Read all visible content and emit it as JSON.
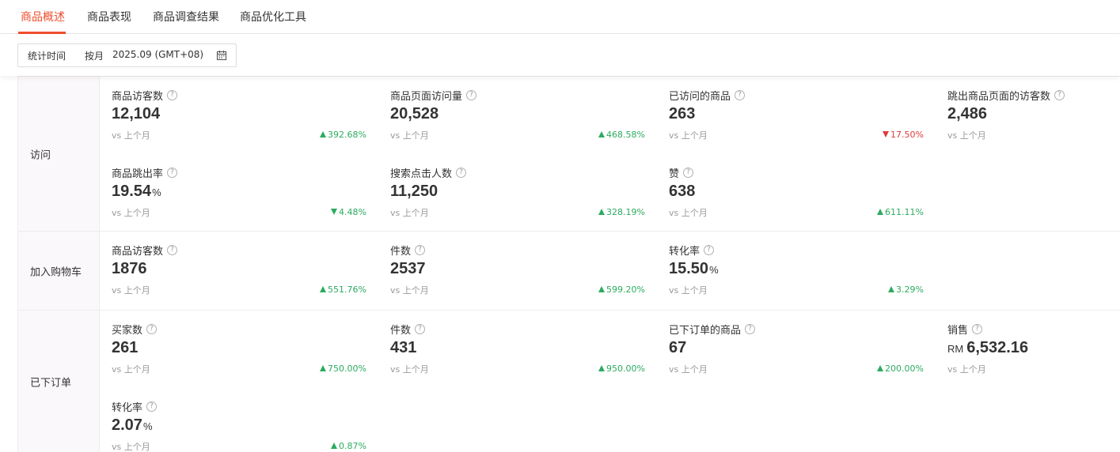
{
  "tabs": [
    {
      "label": "商品概述",
      "active": true
    },
    {
      "label": "商品表现",
      "active": false
    },
    {
      "label": "商品调查结果",
      "active": false
    },
    {
      "label": "商品优化工具",
      "active": false
    }
  ],
  "filter": {
    "label": "统计时间",
    "mode": "按月",
    "value": "2025.09 (GMT+08)",
    "icon": "calendar-icon"
  },
  "colors": {
    "accent": "#ee4d2d",
    "up": "#2dab60",
    "down": "#e03b3b"
  },
  "compare_label": "vs 上个月",
  "sections": [
    {
      "label": "访问",
      "metrics": [
        {
          "title": "商品访客数",
          "value": "12,104",
          "unit": "",
          "prefix": "",
          "change": "392.68%",
          "direction": "up"
        },
        {
          "title": "商品页面访问量",
          "value": "20,528",
          "unit": "",
          "prefix": "",
          "change": "468.58%",
          "direction": "up"
        },
        {
          "title": "已访问的商品",
          "value": "263",
          "unit": "",
          "prefix": "",
          "change": "17.50%",
          "direction": "down"
        },
        {
          "title": "跳出商品页面的访客数",
          "value": "2,486",
          "unit": "",
          "prefix": "",
          "change": "",
          "direction": ""
        },
        {
          "title": "商品跳出率",
          "value": "19.54",
          "unit": "%",
          "prefix": "",
          "change": "4.48%",
          "direction": "down-good"
        },
        {
          "title": "搜索点击人数",
          "value": "11,250",
          "unit": "",
          "prefix": "",
          "change": "328.19%",
          "direction": "up"
        },
        {
          "title": "赞",
          "value": "638",
          "unit": "",
          "prefix": "",
          "change": "611.11%",
          "direction": "up"
        }
      ]
    },
    {
      "label": "加入购物车",
      "metrics": [
        {
          "title": "商品访客数",
          "value": "1876",
          "unit": "",
          "prefix": "",
          "change": "551.76%",
          "direction": "up"
        },
        {
          "title": "件数",
          "value": "2537",
          "unit": "",
          "prefix": "",
          "change": "599.20%",
          "direction": "up"
        },
        {
          "title": "转化率",
          "value": "15.50",
          "unit": "%",
          "prefix": "",
          "change": "3.29%",
          "direction": "up"
        }
      ]
    },
    {
      "label": "已下订单",
      "metrics": [
        {
          "title": "买家数",
          "value": "261",
          "unit": "",
          "prefix": "",
          "change": "750.00%",
          "direction": "up"
        },
        {
          "title": "件数",
          "value": "431",
          "unit": "",
          "prefix": "",
          "change": "950.00%",
          "direction": "up"
        },
        {
          "title": "已下订单的商品",
          "value": "67",
          "unit": "",
          "prefix": "",
          "change": "200.00%",
          "direction": "up"
        },
        {
          "title": "销售",
          "value": "6,532.16",
          "unit": "",
          "prefix": "RM",
          "change": "",
          "direction": ""
        },
        {
          "title": "转化率",
          "value": "2.07",
          "unit": "%",
          "prefix": "",
          "change": "0.87%",
          "direction": "up"
        }
      ]
    }
  ]
}
